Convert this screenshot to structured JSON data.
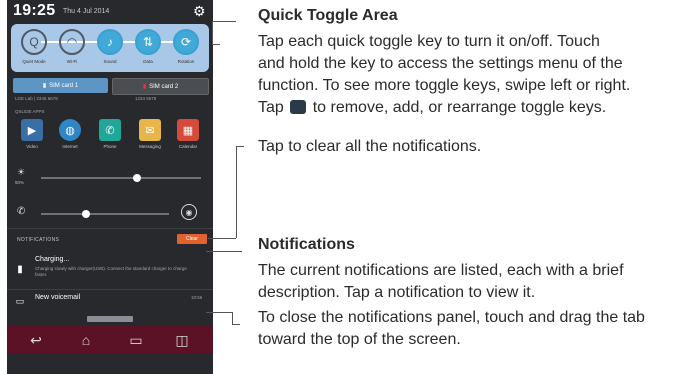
{
  "phone": {
    "time": "19:25",
    "date": "Thu 4 Jul 2014",
    "toggles": [
      {
        "label": "Quiet Mode",
        "state": "off",
        "icon": "quiet-mode-icon"
      },
      {
        "label": "Wi-Fi",
        "state": "off",
        "icon": "wifi-icon"
      },
      {
        "label": "Sound",
        "state": "on",
        "icon": "sound-icon"
      },
      {
        "label": "Data",
        "state": "on",
        "icon": "data-icon"
      },
      {
        "label": "Rotation",
        "state": "on",
        "icon": "rotation-icon"
      }
    ],
    "sim_cards": [
      {
        "label": "SIM card 1",
        "sub": "LGE Lab | 2345 6678"
      },
      {
        "label": "SIM card 2",
        "sub": "1234 5678"
      }
    ],
    "quickslide_header": "QSLIDE APPS",
    "apps": [
      {
        "label": "Video",
        "color": "#3a6fa6"
      },
      {
        "label": "Internet",
        "color": "#2f86c6"
      },
      {
        "label": "Phone",
        "color": "#20a79a"
      },
      {
        "label": "Messaging",
        "color": "#e7b54a"
      },
      {
        "label": "Calendar",
        "color": "#d54a3a"
      }
    ],
    "brightness_label": "50%",
    "brightness_level": 0.6,
    "volume_level": 0.35,
    "notifications_header": "NOTIFICATIONS",
    "clear_label": "Clear",
    "notifications": [
      {
        "title": "Charging...",
        "text": "Charging slowly with charger(USB). Connect the standard charger to charge faster.",
        "time": ""
      },
      {
        "title": "New voicemail",
        "text": "",
        "time": "10:56"
      }
    ]
  },
  "annotations": {
    "quick_toggle": {
      "heading": "Quick Toggle Area",
      "lines": [
        "Tap each quick toggle key to turn it on/off. Touch",
        "and hold the key to access the settings menu of the",
        "function. To see more toggle keys, swipe left or right.",
        "to remove, add, or rearrange toggle keys."
      ],
      "tap_word": "Tap"
    },
    "clear": "Tap to clear all the notifications.",
    "notifications": {
      "heading": "Notifications",
      "lines": [
        "The current notifications are listed, each with a brief",
        "description. Tap a notification to view it."
      ]
    },
    "close": {
      "lines": [
        "To close the notifications panel, touch and drag the tab",
        "toward the top of the screen."
      ]
    }
  }
}
